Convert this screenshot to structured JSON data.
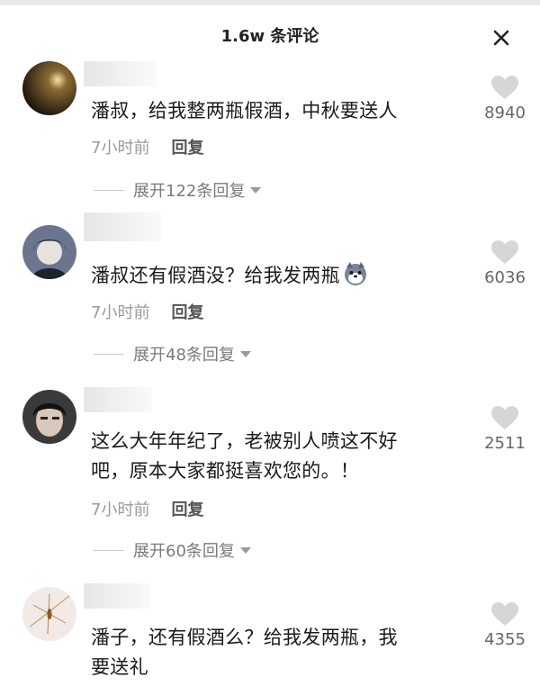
{
  "header": {
    "title": "1.6w 条评论",
    "close_icon": "close-icon"
  },
  "comments": [
    {
      "text": "潘叔，给我整两瓶假酒，中秋要送人",
      "time": "7小时前",
      "reply_label": "回复",
      "expand_label": "展开122条回复",
      "likes": "8940"
    },
    {
      "text": "潘叔还有假酒没？给我发两瓶",
      "emoji": "dog-face-emoji",
      "time": "7小时前",
      "reply_label": "回复",
      "expand_label": "展开48条回复",
      "likes": "6036"
    },
    {
      "text_line1": "这么大年年纪了，老被别人喷这不好",
      "text_line2": "吧，原本大家都挺喜欢您的。！",
      "time": "7小时前",
      "reply_label": "回复",
      "expand_label": "展开60条回复",
      "likes": "2511"
    },
    {
      "text_line1": "潘子，还有假酒么？给我发两瓶，我",
      "text_line2": "要送礼",
      "likes": "4355"
    }
  ],
  "colors": {
    "text": "#1a1a1a",
    "meta": "#9a9a9a",
    "like_icon": "#d6d6d6"
  }
}
